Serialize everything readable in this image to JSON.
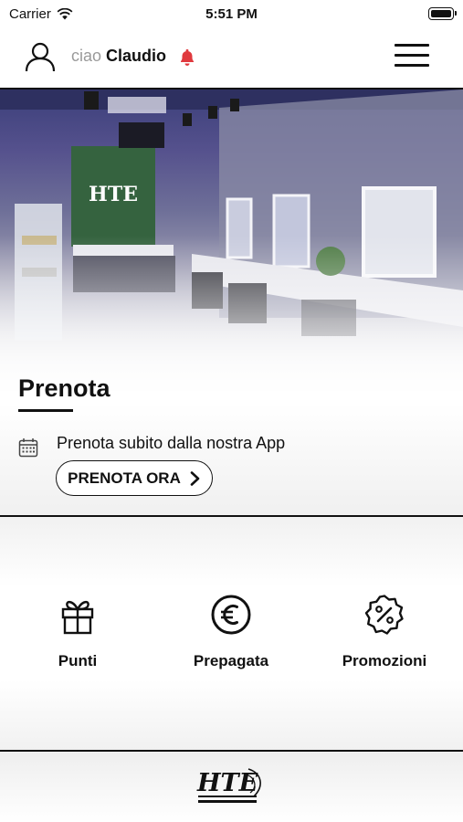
{
  "status_bar": {
    "carrier": "Carrier",
    "time": "5:51 PM"
  },
  "header": {
    "greeting": "ciao",
    "user_name": "Claudio"
  },
  "hero": {
    "title": "Prenota",
    "description": "Prenota subito dalla nostra App",
    "cta_label": "PRENOTA ORA",
    "photo_logo_text": "HTE"
  },
  "features": [
    {
      "label": "Punti",
      "icon": "gift-icon"
    },
    {
      "label": "Prepagata",
      "icon": "euro-icon"
    },
    {
      "label": "Promozioni",
      "icon": "percent-badge-icon"
    }
  ],
  "footer": {
    "logo_text": "HTE"
  },
  "colors": {
    "accent": "#e0393e",
    "text": "#111111",
    "muted": "#9a9a9a"
  }
}
